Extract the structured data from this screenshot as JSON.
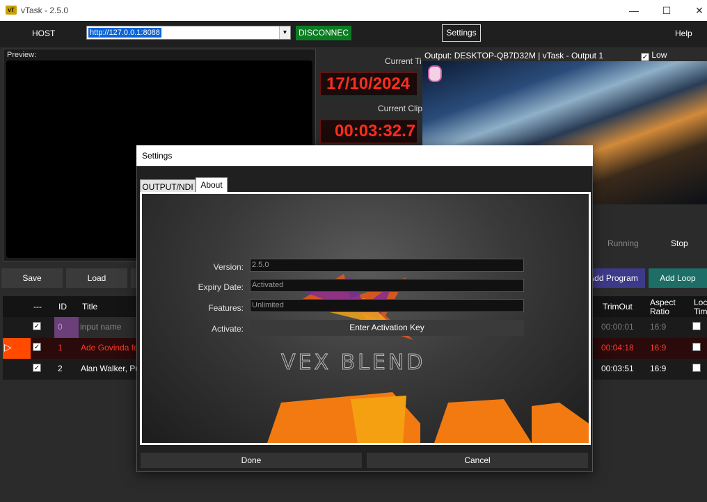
{
  "window": {
    "title": "vTask - 2.5.0",
    "icon": "app-icon"
  },
  "toolbar": {
    "host_label": "HOST",
    "host_value": "http://127.0.0.1:8088",
    "disconnect_label": "DISCONNEC",
    "settings_label": "Settings",
    "help_label": "Help"
  },
  "preview": {
    "label": "Preview:"
  },
  "timers": {
    "current_time_label": "Current Ti",
    "current_time_value": "17/10/2024",
    "current_clip_label": "Current Clip",
    "current_clip_value": "00:03:32.7"
  },
  "output": {
    "label": "Output: DESKTOP-QB7D32M | vTask - Output 1",
    "low_bandwidth_label": "Low Bandwidth",
    "low_bandwidth_checked": true,
    "running_label": "Running",
    "stop_label": "Stop"
  },
  "buttons": {
    "save": "Save",
    "load": "Load",
    "add_program": "Add Program",
    "add_loop": "Add Loop"
  },
  "table": {
    "headers": {
      "check": "---",
      "id": "ID",
      "title": "Title",
      "trimout": "TrimOut",
      "aspect": "Aspect\nRatio",
      "lock": "Lock\nTime"
    },
    "rows": [
      {
        "id": "0",
        "title": "input name",
        "trimout": "00:00:01",
        "aspect": "16:9"
      },
      {
        "id": "1",
        "title": "Ade Govinda fea",
        "trimout": "00:04:18",
        "aspect": "16:9"
      },
      {
        "id": "2",
        "title": "Alan Walker, Put",
        "trimout": "00:03:51",
        "aspect": "16:9"
      }
    ]
  },
  "dialog": {
    "title": "Settings",
    "tabs": [
      "OUTPUT/NDI",
      "About"
    ],
    "version_label": "Version:",
    "version_value": "2.5.0",
    "expiry_label": "Expiry Date:",
    "expiry_value": "Activated",
    "features_label": "Features:",
    "features_value": "Unlimited",
    "activate_label": "Activate:",
    "activate_button": "Enter Activation Key",
    "logo_text": "VEX BLEND",
    "done_label": "Done",
    "cancel_label": "Cancel"
  }
}
